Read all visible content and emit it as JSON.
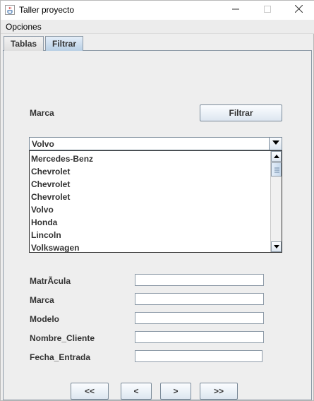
{
  "window": {
    "title": "Taller proyecto"
  },
  "menu": {
    "opciones": "Opciones"
  },
  "tabs": {
    "tablas": "Tablas",
    "filtrar": "Filtrar"
  },
  "filter": {
    "marca_label": "Marca",
    "filtrar_button": "Filtrar",
    "selected": "Volvo",
    "options": [
      "Mercedes-Benz",
      "Chevrolet",
      "Chevrolet",
      "Chevrolet",
      "Volvo",
      "Honda",
      "Lincoln",
      "Volkswagen"
    ]
  },
  "form": {
    "matricula_label": "MatrÃ­cula",
    "marca_label": "Marca",
    "modelo_label": "Modelo",
    "nombre_cliente_label": "Nombre_Cliente",
    "fecha_entrada_label": "Fecha_Entrada",
    "matricula_value": "",
    "marca_value": "",
    "modelo_value": "",
    "nombre_cliente_value": "",
    "fecha_entrada_value": ""
  },
  "nav": {
    "first": "<<",
    "prev": "<",
    "next": ">",
    "last": ">>"
  },
  "icons": {
    "app": "java-coffee-icon",
    "minimize": "minimize-icon",
    "maximize": "maximize-icon",
    "close": "close-icon",
    "combo_arrow": "chevron-down-icon"
  }
}
